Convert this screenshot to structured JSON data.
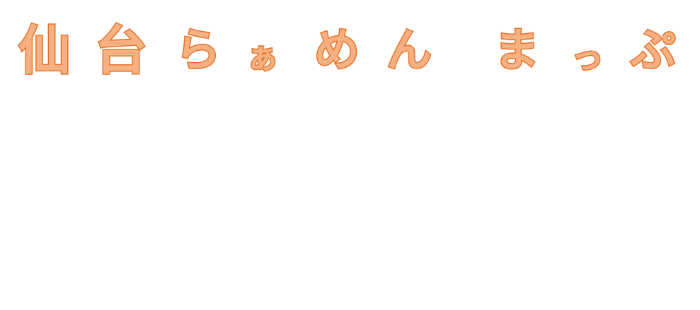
{
  "logo": {
    "title": "仙台らぁめん まっぷ",
    "glyphs": [
      "仙",
      "台",
      "ら",
      "ぁ",
      "め",
      "ん",
      "ま",
      "っ",
      "ぷ"
    ]
  },
  "colors": {
    "fill": "#F6B183",
    "outline": "#E8732A",
    "background": "#FFFFFF"
  }
}
